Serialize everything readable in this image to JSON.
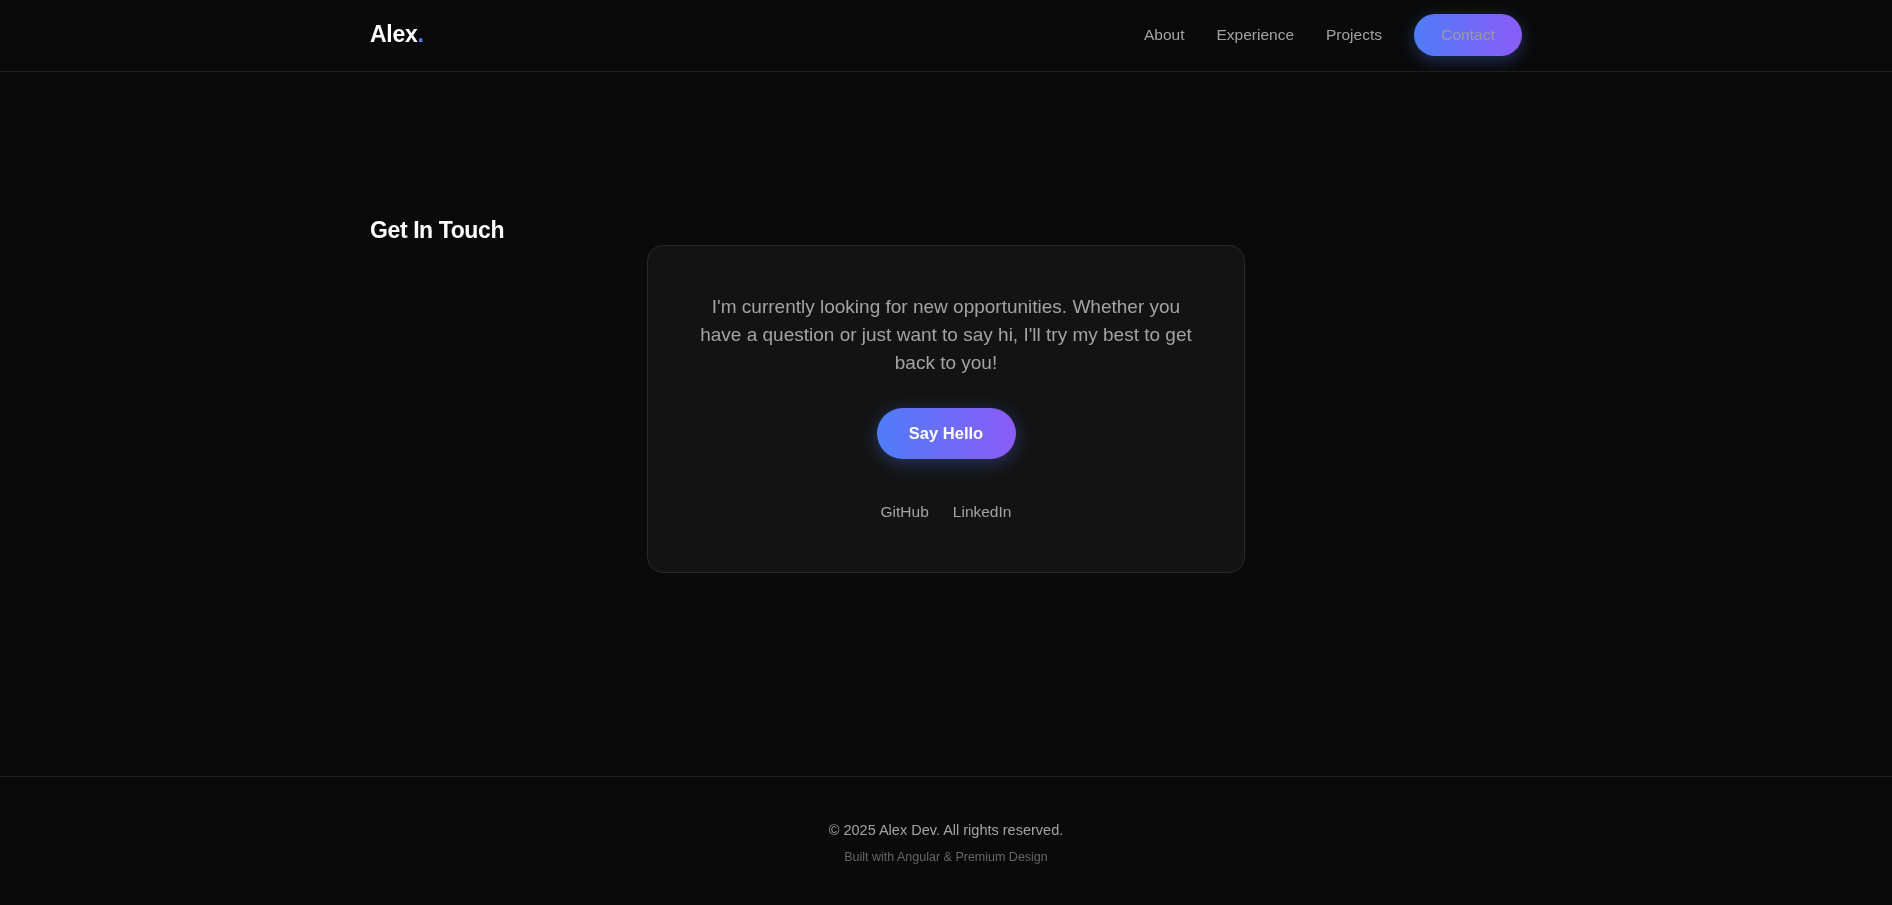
{
  "header": {
    "logo": "Alex",
    "logo_accent": ".",
    "nav": [
      {
        "label": "About"
      },
      {
        "label": "Experience"
      },
      {
        "label": "Projects"
      }
    ],
    "cta": "Contact"
  },
  "contact": {
    "heading": "Get In Touch",
    "message": "I'm currently looking for new opportunities. Whether you have a question or just want to say hi, I'll try my best to get back to you!",
    "button": "Say Hello",
    "links": [
      "GitHub",
      "LinkedIn"
    ]
  },
  "footer": {
    "copyright": "© 2025 Alex Dev. All rights reserved.",
    "credit": "Built with Angular & Premium Design"
  }
}
